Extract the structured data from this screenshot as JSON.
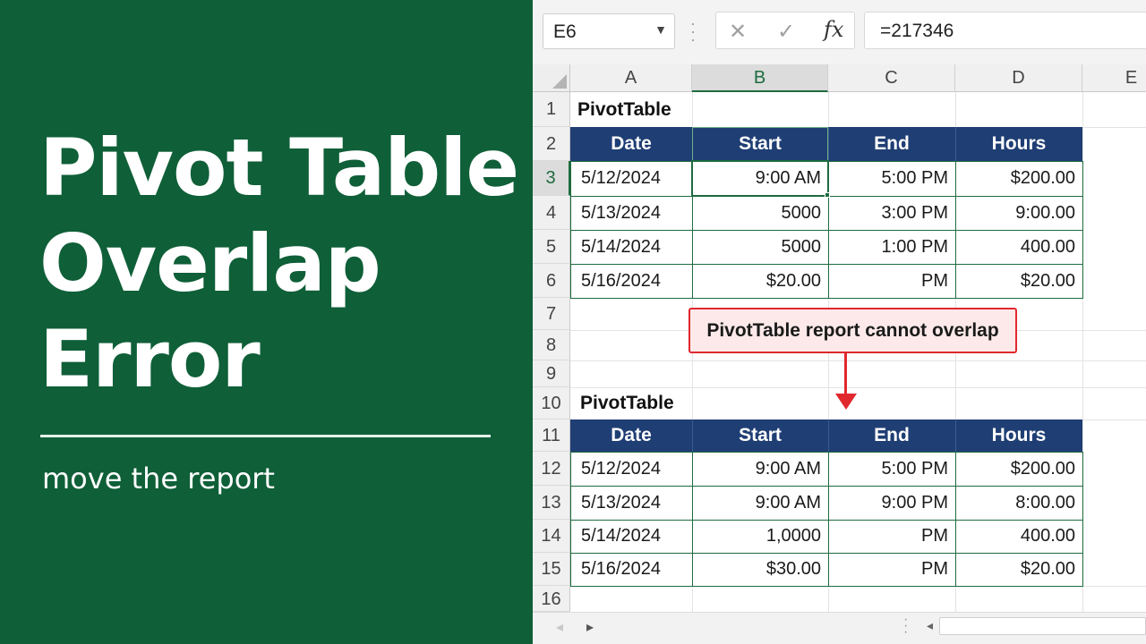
{
  "thumbnail": {
    "title_lines": [
      "Pivot Table",
      "Overlap",
      "Error"
    ],
    "subtitle": "move the report",
    "background_color": "#0f5f38"
  },
  "excel": {
    "name_box": "E6",
    "formula_icons": {
      "cancel": "cancel-x-icon",
      "enter": "checkmark-icon",
      "function": "fx-icon"
    },
    "fx_label": "fx",
    "formula": "=217346",
    "columns": [
      "A",
      "B",
      "C",
      "D",
      "E"
    ],
    "selected_column": "B",
    "rows": [
      "1",
      "2",
      "3",
      "4",
      "5",
      "6",
      "7",
      "8",
      "9",
      "10",
      "11",
      "12",
      "13",
      "14",
      "15",
      "16"
    ],
    "selected_row": "3",
    "pivot1": {
      "label": "PivotTable",
      "headers": [
        "Date",
        "Start",
        "End",
        "Hours"
      ],
      "rows": [
        [
          "5/12/2024",
          "9:00 AM",
          "5:00 PM",
          "$200.00"
        ],
        [
          "5/13/2024",
          "5000",
          "3:00 PM",
          "9:00.00"
        ],
        [
          "5/14/2024",
          "5000",
          "1:00 PM",
          "400.00"
        ],
        [
          "5/16/2024",
          "$20.00",
          "PM",
          "$20.00"
        ]
      ]
    },
    "callout": "PivotTable report cannot overlap",
    "pivot2": {
      "label": "PivotTable",
      "headers": [
        "Date",
        "Start",
        "End",
        "Hours"
      ],
      "rows": [
        [
          "5/12/2024",
          "9:00 AM",
          "5:00 PM",
          "$200.00"
        ],
        [
          "5/13/2024",
          "9:00 AM",
          "9:00 PM",
          "8:00.00"
        ],
        [
          "5/14/2024",
          "1,0000",
          "PM",
          "400.00"
        ],
        [
          "5/16/2024",
          "$30.00",
          "PM",
          "$20.00"
        ]
      ]
    },
    "accent_color": "#1d6b3f",
    "header_color": "#1f3e74",
    "callout_color": "#e0282e"
  }
}
